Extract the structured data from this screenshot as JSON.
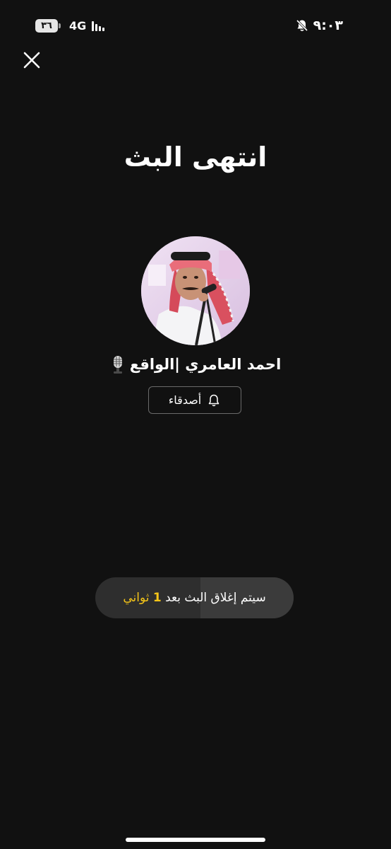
{
  "status_bar": {
    "time": "٩:٠٣",
    "battery": "٣٦",
    "network": "4G",
    "mute_icon": "bell-slash-icon",
    "signal_icon": "signal-bars-icon"
  },
  "header": {
    "close_icon": "close-icon"
  },
  "main": {
    "title": "انتهى البث",
    "host": {
      "name": "احمد العامري |الواقع",
      "badge_icon": "microphone-icon",
      "avatar_icon": "avatar-photo"
    },
    "friends_button": {
      "label": "أصدقاء",
      "icon": "bell-icon"
    }
  },
  "countdown": {
    "prefix": "سيتم إغلاق البث بعد",
    "seconds": "1",
    "unit": "ثواني",
    "progress": 0.47,
    "highlight_color": "#f5c518"
  },
  "colors": {
    "background": "#111111",
    "pill": "#2e2e2e",
    "accent": "#f5c518"
  }
}
